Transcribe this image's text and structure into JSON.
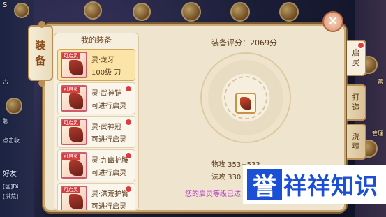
{
  "panel": {
    "side_tab": [
      "装",
      "备"
    ],
    "list_title": "我的装备",
    "score_label": "装备评分：2069分",
    "close_label": "✕"
  },
  "equipment": [
    {
      "name": "灵·龙牙",
      "sub": "100级 刀",
      "tag": "可启灵",
      "selected": true,
      "badge": false
    },
    {
      "name": "灵·武神铠",
      "sub": "可进行启灵",
      "tag": "可启灵",
      "selected": false,
      "badge": true
    },
    {
      "name": "灵·武神冠",
      "sub": "可进行启灵",
      "tag": "可启灵",
      "selected": false,
      "badge": true
    },
    {
      "name": "灵·九幽护腰",
      "sub": "可进行启灵",
      "tag": "可启灵",
      "selected": false,
      "badge": true
    },
    {
      "name": "灵·洪荒护臂",
      "sub": "可进行启灵",
      "tag": "可启灵",
      "selected": false,
      "badge": true
    }
  ],
  "stats": [
    {
      "text": "物攻  353+533"
    },
    {
      "text": "法攻  330"
    }
  ],
  "notice": "您的启灵等级已达",
  "right_tabs": [
    {
      "label": [
        "启",
        "灵"
      ],
      "active": true,
      "badge": true
    },
    {
      "label": [
        "打",
        "造"
      ],
      "active": false,
      "badge": false
    },
    {
      "label": [
        "洗",
        "魂"
      ],
      "active": false,
      "badge": false
    }
  ],
  "background": {
    "left_texts": [
      "古",
      "聊",
      "点击收",
      "好友",
      "[区]Di",
      "[洪荒]"
    ],
    "right_texts": [
      "蓝",
      "管理"
    ],
    "top_texts": [
      "S"
    ]
  },
  "watermark": {
    "chip": "誉",
    "text": "祥祥知识"
  },
  "colors": {
    "accent": "#1b4fd6",
    "badge": "#e23a3a",
    "notice": "#b23acb",
    "frame": "#c9a874"
  }
}
